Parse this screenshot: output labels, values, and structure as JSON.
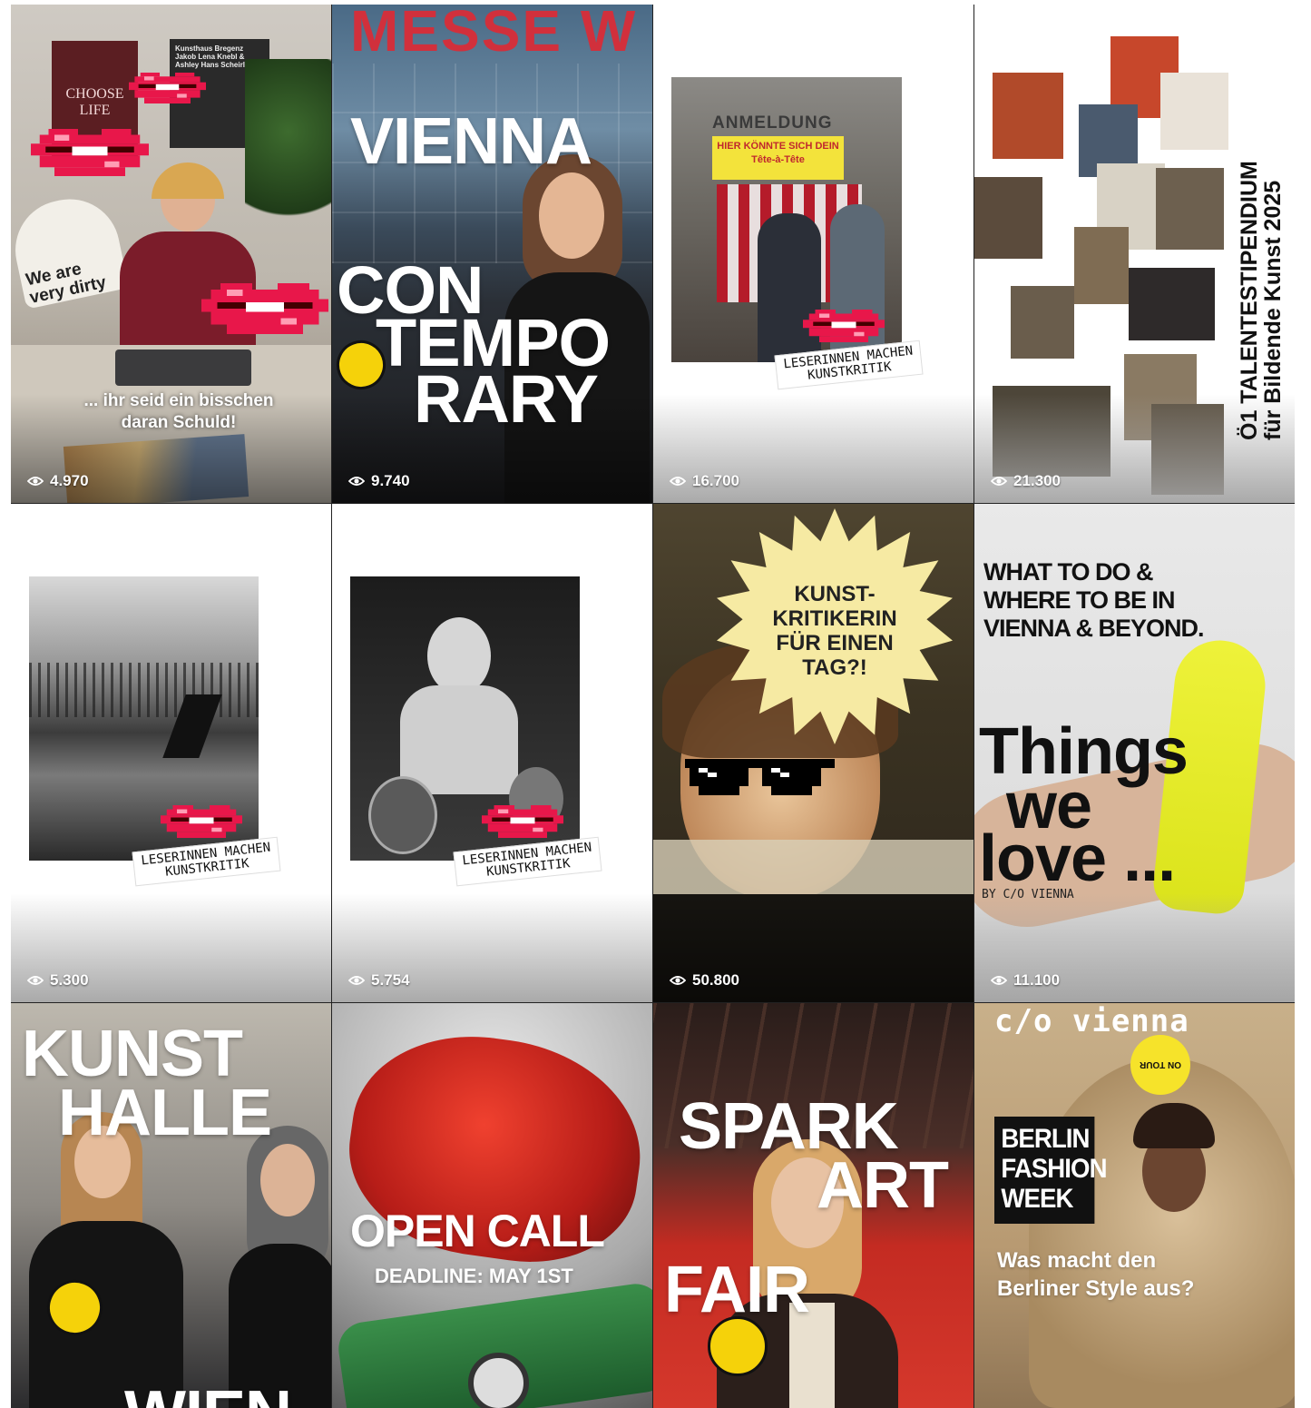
{
  "tiles": [
    {
      "views": "4.970",
      "caption": "... ihr seid ein bisschen daran Schuld!",
      "lamp_text": "We are very dirty",
      "poster_left": "CHOOSE LIFE",
      "poster_right": "Kunsthaus Bregenz\nJakob Lena Knebl &\nAshley Hans Scheirl"
    },
    {
      "views": "9.740",
      "line1": "VIENNA",
      "line2": "CON",
      "line3": "TEMPO",
      "line4": "RARY",
      "sign": "MESSE W"
    },
    {
      "views": "16.700",
      "sign": "ANMELDUNG",
      "banner": "HIER KÖNNTE SICH DEIN\nTête-à-Tête",
      "sticker": "LESERINNEN MACHEN\nKUNSTKRITIK"
    },
    {
      "views": "21.300",
      "side_line1": "Ö1 TALENTESTIPENDIUM",
      "side_line2": "für Bildende Kunst 2025"
    },
    {
      "views": "5.300",
      "sticker": "LESERINNEN MACHEN\nKUNSTKRITIK"
    },
    {
      "views": "5.754",
      "sticker": "LESERINNEN MACHEN\nKUNSTKRITIK"
    },
    {
      "views": "50.800",
      "burst": "KUNST-\nKRITIKERIN\nFÜR EINEN\nTAG?!"
    },
    {
      "views": "11.100",
      "headline": "WHAT TO DO &\nWHERE TO BE IN\nVIENNA & BEYOND.",
      "big1": "Things",
      "big2": "we",
      "big3": "love ...",
      "by": "BY C/O VIENNA"
    },
    {
      "line1": "KUNST",
      "line2": "HALLE",
      "line3": "WIEN"
    },
    {
      "title": "OPEN CALL",
      "sub": "DEADLINE: MAY 1ST"
    },
    {
      "line1": "SPARK",
      "line2": "ART",
      "line3": "FAIR"
    },
    {
      "brand": "c/o vienna",
      "badge": "ON TOUR",
      "box": "BERLIN\nFASHION\nWEEK",
      "question": "Was macht den\nBerliner Style aus?"
    }
  ],
  "colors": {
    "lips": "#e8174a",
    "burst": "#f6eaa3",
    "mic": "#f5d20a",
    "parakeet": "#e6ef1c"
  }
}
